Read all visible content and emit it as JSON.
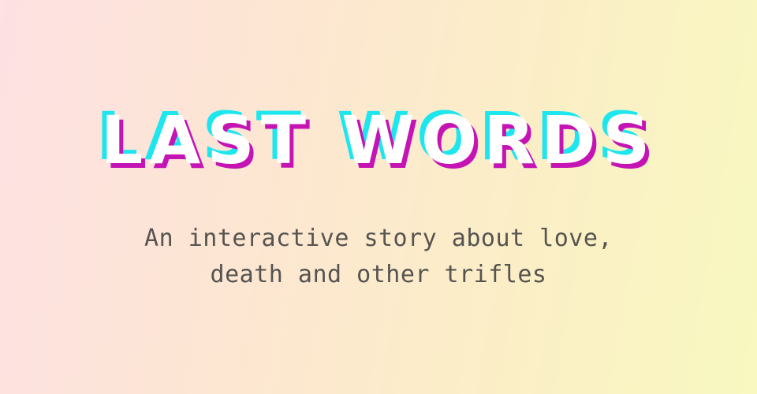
{
  "title": {
    "text": "LAST WORDS",
    "colors": {
      "fill": "#ffffff",
      "shadow_cyan": "#1ee6ee",
      "shadow_magenta": "#c414b4"
    }
  },
  "subtitle": {
    "line1": "An interactive story about love,",
    "line2": "death and other trifles",
    "color": "#555450"
  },
  "background": {
    "gradient": [
      "#fde1e3",
      "#fde6d2",
      "#fbefc6",
      "#f8f8c0"
    ]
  }
}
